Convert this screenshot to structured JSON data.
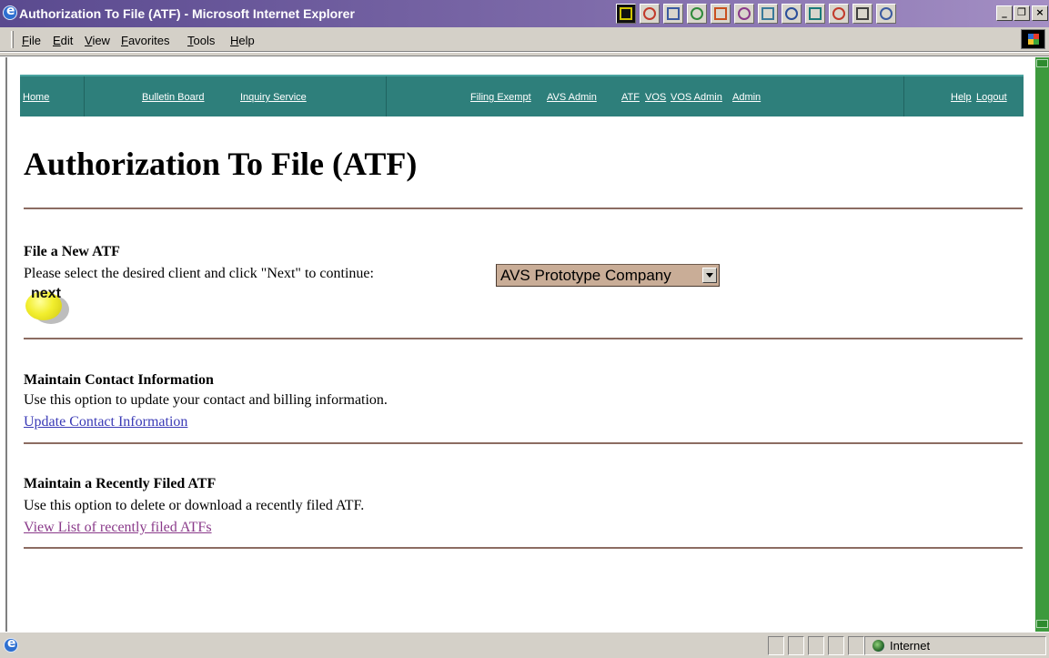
{
  "window": {
    "title": "Authorization To File (ATF) - Microsoft Internet Explorer",
    "controls": {
      "minimize": "_",
      "maximize": "❐",
      "close": "×"
    }
  },
  "menubar": {
    "items": [
      "File",
      "Edit",
      "View",
      "Favorites",
      "Tools",
      "Help"
    ]
  },
  "tray_icons": [
    "app-grid-icon",
    "refresh-icon",
    "word-icon",
    "excel-icon",
    "powerpoint-icon",
    "pen-icon",
    "calculator-icon",
    "network-icon",
    "monitor-icon",
    "pdf-icon",
    "window-icon",
    "search-icon"
  ],
  "nav": {
    "home": "Home",
    "bulletin_board": "Bulletin Board",
    "inquiry_service": "Inquiry Service",
    "filing_exempt": "Filing Exempt",
    "avs_admin": "AVS Admin",
    "atf": "ATF",
    "vos": "VOS",
    "vos_admin": "VOS Admin",
    "admin": "Admin",
    "help": "Help",
    "logout": "Logout"
  },
  "page": {
    "title": "Authorization To File (ATF)"
  },
  "sections": {
    "new_atf": {
      "title": "File a New ATF",
      "instruction": "Please select the desired client and click \"Next\" to continue:",
      "client_select_value": "AVS Prototype Company",
      "next_button": "next"
    },
    "contact": {
      "title": "Maintain Contact Information",
      "description": "Use this option to update your contact and billing information.",
      "link": "Update Contact Information"
    },
    "recent": {
      "title": "Maintain a Recently Filed ATF",
      "description": "Use this option to delete or download a recently filed ATF.",
      "link": "View List of recently filed ATFs"
    }
  },
  "colors": {
    "nav_bg": "#2e7f7b",
    "link_unvisited": "#3a3ab6",
    "link_visited": "#8a3a8a",
    "rule": "#8c6c62",
    "scrollbar": "#3d9a3d"
  },
  "statusbar": {
    "zone": "Internet"
  }
}
